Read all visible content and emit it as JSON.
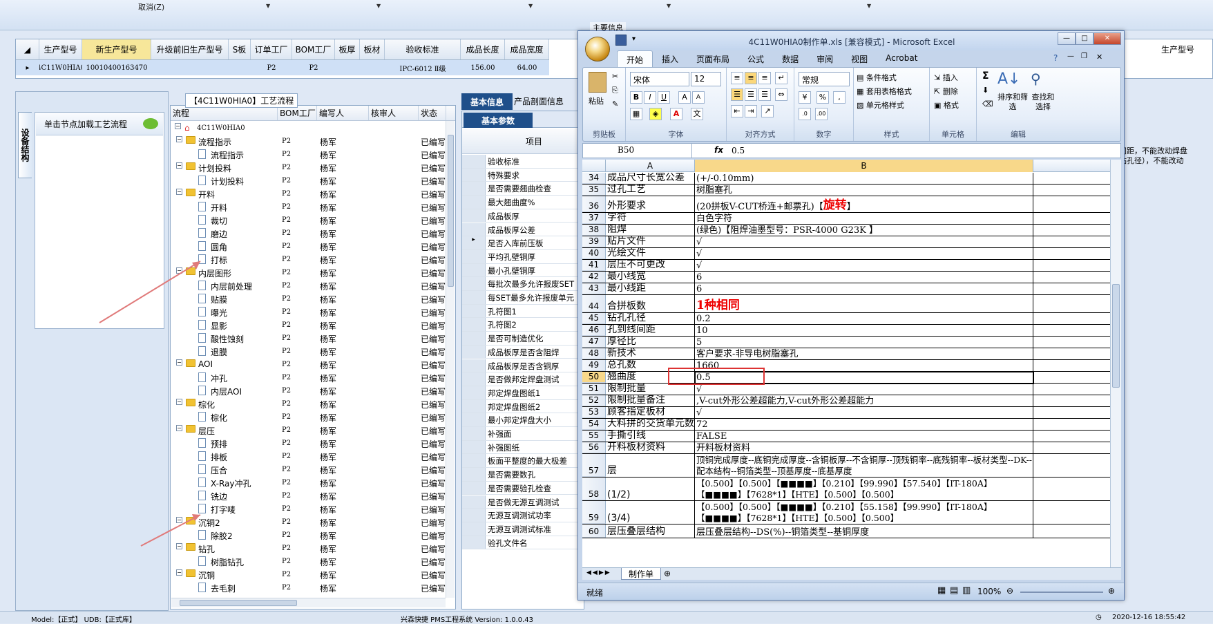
{
  "topbar": {
    "cancel": "取消(Z)",
    "group_title": "主要信息"
  },
  "grid": {
    "columns": [
      "生产型号",
      "新生产型号",
      "升级前旧生产型号",
      "S板",
      "订单工厂",
      "BOM工厂",
      "板厚",
      "板材",
      "验收标准",
      "成品长度",
      "成品宽度"
    ],
    "row": {
      "pointer": "▸",
      "prod": "4C11W0HIA0",
      "new": "10010400163470",
      "old": "",
      "s": "",
      "order": "P2",
      "bom": "P2",
      "thick": "",
      "mat": "",
      "std": "IPC-6012 Ⅱ级",
      "len": "156.00",
      "wid": "64.00"
    },
    "right_col": "生产型号"
  },
  "left": {
    "vtab": "设备结构",
    "node_hint": "单击节点加载工艺流程"
  },
  "tree": {
    "title": "【4C11W0HIA0】工艺流程",
    "columns": [
      "流程",
      "BOM工厂",
      "编写人",
      "核审人",
      "状态"
    ],
    "root": "4C11W0HIA0",
    "rows": [
      {
        "lvl": 1,
        "type": "folder",
        "name": "流程指示",
        "f": "P2",
        "w": "杨军",
        "s": "已编写"
      },
      {
        "lvl": 2,
        "type": "doc",
        "name": "流程指示",
        "f": "P2",
        "w": "杨军",
        "s": "已编写"
      },
      {
        "lvl": 1,
        "type": "folder",
        "name": "计划投料",
        "f": "P2",
        "w": "杨军",
        "s": "已编写"
      },
      {
        "lvl": 2,
        "type": "doc",
        "name": "计划投料",
        "f": "P2",
        "w": "杨军",
        "s": "已编写"
      },
      {
        "lvl": 1,
        "type": "folder",
        "name": "开料",
        "f": "P2",
        "w": "杨军",
        "s": "已编写"
      },
      {
        "lvl": 2,
        "type": "doc",
        "name": "开料",
        "f": "P2",
        "w": "杨军",
        "s": "已编写"
      },
      {
        "lvl": 2,
        "type": "doc",
        "name": "裁切",
        "f": "P2",
        "w": "杨军",
        "s": "已编写"
      },
      {
        "lvl": 2,
        "type": "doc",
        "name": "磨边",
        "f": "P2",
        "w": "杨军",
        "s": "已编写"
      },
      {
        "lvl": 2,
        "type": "doc",
        "name": "圆角",
        "f": "P2",
        "w": "杨军",
        "s": "已编写"
      },
      {
        "lvl": 2,
        "type": "doc",
        "name": "打标",
        "f": "P2",
        "w": "杨军",
        "s": "已编写"
      },
      {
        "lvl": 1,
        "type": "folder",
        "name": "内层图形",
        "f": "P2",
        "w": "杨军",
        "s": "已编写"
      },
      {
        "lvl": 2,
        "type": "doc",
        "name": "内层前处理",
        "f": "P2",
        "w": "杨军",
        "s": "已编写"
      },
      {
        "lvl": 2,
        "type": "doc",
        "name": "贴膜",
        "f": "P2",
        "w": "杨军",
        "s": "已编写"
      },
      {
        "lvl": 2,
        "type": "doc",
        "name": "曝光",
        "f": "P2",
        "w": "杨军",
        "s": "已编写"
      },
      {
        "lvl": 2,
        "type": "doc",
        "name": "显影",
        "f": "P2",
        "w": "杨军",
        "s": "已编写"
      },
      {
        "lvl": 2,
        "type": "doc",
        "name": "酸性蚀刻",
        "f": "P2",
        "w": "杨军",
        "s": "已编写"
      },
      {
        "lvl": 2,
        "type": "doc",
        "name": "退膜",
        "f": "P2",
        "w": "杨军",
        "s": "已编写"
      },
      {
        "lvl": 1,
        "type": "folder",
        "name": "AOI",
        "f": "P2",
        "w": "杨军",
        "s": "已编写"
      },
      {
        "lvl": 2,
        "type": "doc",
        "name": "冲孔",
        "f": "P2",
        "w": "杨军",
        "s": "已编写"
      },
      {
        "lvl": 2,
        "type": "doc",
        "name": "内层AOI",
        "f": "P2",
        "w": "杨军",
        "s": "已编写"
      },
      {
        "lvl": 1,
        "type": "folder",
        "name": "棕化",
        "f": "P2",
        "w": "杨军",
        "s": "已编写"
      },
      {
        "lvl": 2,
        "type": "doc",
        "name": "棕化",
        "f": "P2",
        "w": "杨军",
        "s": "已编写"
      },
      {
        "lvl": 1,
        "type": "folder",
        "name": "层压",
        "f": "P2",
        "w": "杨军",
        "s": "已编写"
      },
      {
        "lvl": 2,
        "type": "doc",
        "name": "预排",
        "f": "P2",
        "w": "杨军",
        "s": "已编写"
      },
      {
        "lvl": 2,
        "type": "doc",
        "name": "排板",
        "f": "P2",
        "w": "杨军",
        "s": "已编写"
      },
      {
        "lvl": 2,
        "type": "doc",
        "name": "压合",
        "f": "P2",
        "w": "杨军",
        "s": "已编写"
      },
      {
        "lvl": 2,
        "type": "doc",
        "name": "X-Ray冲孔",
        "f": "P2",
        "w": "杨军",
        "s": "已编写"
      },
      {
        "lvl": 2,
        "type": "doc",
        "name": "铣边",
        "f": "P2",
        "w": "杨军",
        "s": "已编写"
      },
      {
        "lvl": 2,
        "type": "doc",
        "name": "打字唛",
        "f": "P2",
        "w": "杨军",
        "s": "已编写"
      },
      {
        "lvl": 1,
        "type": "folder",
        "name": "沉铜2",
        "f": "P2",
        "w": "杨军",
        "s": "已编写"
      },
      {
        "lvl": 2,
        "type": "doc",
        "name": "除胶2",
        "f": "P2",
        "w": "杨军",
        "s": "已编写"
      },
      {
        "lvl": 1,
        "type": "folder",
        "name": "钻孔",
        "f": "P2",
        "w": "杨军",
        "s": "已编写"
      },
      {
        "lvl": 2,
        "type": "doc",
        "name": "树脂钻孔",
        "f": "P2",
        "w": "杨军",
        "s": "已编写"
      },
      {
        "lvl": 1,
        "type": "folder",
        "name": "沉铜",
        "f": "P2",
        "w": "杨军",
        "s": "已编写"
      },
      {
        "lvl": 2,
        "type": "doc",
        "name": "去毛刺",
        "f": "P2",
        "w": "杨军",
        "s": "已编写"
      }
    ]
  },
  "middle": {
    "tab_basic": "基本信息",
    "tab_profile": "产品剖面信息",
    "subtab": "基本参数",
    "column": "项目",
    "items": [
      "验收标准",
      "特殊要求",
      "是否需要翘曲检查",
      "最大翘曲度%",
      "成品板厚",
      "成品板厚公差",
      "是否入库前压板",
      "平均孔壁铜厚",
      "最小孔壁铜厚",
      "每批次最多允许报废SET",
      "每SET最多允许报废单元",
      "孔符图1",
      "孔符图2",
      "是否可制造优化",
      "成品板厚是否含阻焊",
      "成品板厚是否含铜厚",
      "是否做邦定焊盘测试",
      "邦定焊盘图纸1",
      "邦定焊盘图纸2",
      "最小邦定焊盘大小",
      "补强面",
      "补强图纸",
      "板面平整度的最大极差",
      "是否需要数孔",
      "是否需要验孔检查",
      "是否做无源互调测试",
      "无源互调测试功率",
      "无源互调测试标准",
      "验孔文件名"
    ]
  },
  "rightbg": {
    "line1": "间距，不能改动焊盘",
    "line2": "钻孔径），不能改动"
  },
  "status": {
    "left": "Model:【正式】 UDB:【正式库】",
    "center": "兴森快捷 PMS工程系统 Version: 1.0.0.43",
    "right": "2020-12-16 18:55:42"
  },
  "excel": {
    "title": "4C11W0HIA0制作单.xls  [兼容模式] - Microsoft Excel",
    "tabs": [
      "开始",
      "插入",
      "页面布局",
      "公式",
      "数据",
      "审阅",
      "视图",
      "Acrobat"
    ],
    "ribbon": {
      "paste": "粘贴",
      "clipboard": "剪贴板",
      "font_name": "宋体",
      "font_size": "12",
      "font": "字体",
      "align": "对齐方式",
      "numfmt": "常规",
      "number": "数字",
      "cond_fmt": "条件格式",
      "table_fmt": "套用表格格式",
      "cell_style": "单元格样式",
      "style": "样式",
      "insert": "插入",
      "delete": "删除",
      "format": "格式",
      "cells": "单元格",
      "sort": "排序和筛选",
      "find": "查找和选择",
      "edit": "编辑"
    },
    "namebox": "B50",
    "fx": "fx",
    "formula": "0.5",
    "col_a": "A",
    "col_b": "B",
    "sheet_tab": "制作单",
    "status_ready": "就绪",
    "zoom": "100%",
    "rows": [
      {
        "n": "34",
        "a": "成品尺寸长宽公差",
        "b": "(+/-0.10mm)"
      },
      {
        "n": "35",
        "a": "过孔工艺",
        "b": "树脂塞孔"
      },
      {
        "n": "36",
        "a": "外形要求",
        "b": "(20拼板V-CUT桥连+邮票孔)【",
        "b_red": "旋转",
        "b_tail": "】"
      },
      {
        "n": "37",
        "a": "字符",
        "b": "白色字符"
      },
      {
        "n": "38",
        "a": "阻焊",
        "b": "(绿色)【阻焊油墨型号：PSR-4000 G23K 】"
      },
      {
        "n": "39",
        "a": "贴片文件",
        "b": "√"
      },
      {
        "n": "40",
        "a": "光绘文件",
        "b": "√"
      },
      {
        "n": "41",
        "a": "层压不可更改",
        "b": "√"
      },
      {
        "n": "42",
        "a": "最小线宽",
        "b": "6"
      },
      {
        "n": "43",
        "a": "最小线距",
        "b": "6"
      },
      {
        "n": "44",
        "a": "合拼板数",
        "b": "",
        "b_red": "1种相同",
        "b_tail": ""
      },
      {
        "n": "45",
        "a": "钻孔孔径",
        "b": "0.2"
      },
      {
        "n": "46",
        "a": "孔到线间距",
        "b": "10"
      },
      {
        "n": "47",
        "a": "厚径比",
        "b": "5"
      },
      {
        "n": "48",
        "a": "新技术",
        "b": "客户要求-非导电树脂塞孔"
      },
      {
        "n": "49",
        "a": "总孔数",
        "b": "1660"
      },
      {
        "n": "50",
        "a": "翘曲度",
        "b": "0.5"
      },
      {
        "n": "51",
        "a": "限制批量",
        "b": "√"
      },
      {
        "n": "52",
        "a": "限制批量备注",
        "b": ",V-cut外形公差超能力,V-cut外形公差超能力"
      },
      {
        "n": "53",
        "a": "顾客指定板材",
        "b": "√"
      },
      {
        "n": "54",
        "a": "大料拼的交货单元数",
        "b": "72"
      },
      {
        "n": "55",
        "a": "手撕引线",
        "b": "FALSE"
      },
      {
        "n": "56",
        "a": "开料板材资料",
        "b": "开料板材资料"
      },
      {
        "n": "57",
        "a": "层",
        "b": "顶铜完成厚度--底铜完成厚度--含铜板厚--不含铜厚--顶残铜率--底残铜率--板材类型--DK--配本结构--铜箔类型--顶基厚度--底基厚度"
      },
      {
        "n": "58",
        "a": "(1/2)",
        "b": "【0.500】【0.500】【■■■■】【0.210】【99.990】【57.540】【IT-180A】【■■■■】【7628*1】【HTE】【0.500】【0.500】"
      },
      {
        "n": "59",
        "a": "(3/4)",
        "b": "【0.500】【0.500】【■■■■】【0.210】【55.158】【99.990】【IT-180A】【■■■■】【7628*1】【HTE】【0.500】【0.500】"
      },
      {
        "n": "60",
        "a": "层压叠层结构",
        "b": "层压叠层结构--DS(%)--铜箔类型--基铜厚度"
      }
    ]
  }
}
